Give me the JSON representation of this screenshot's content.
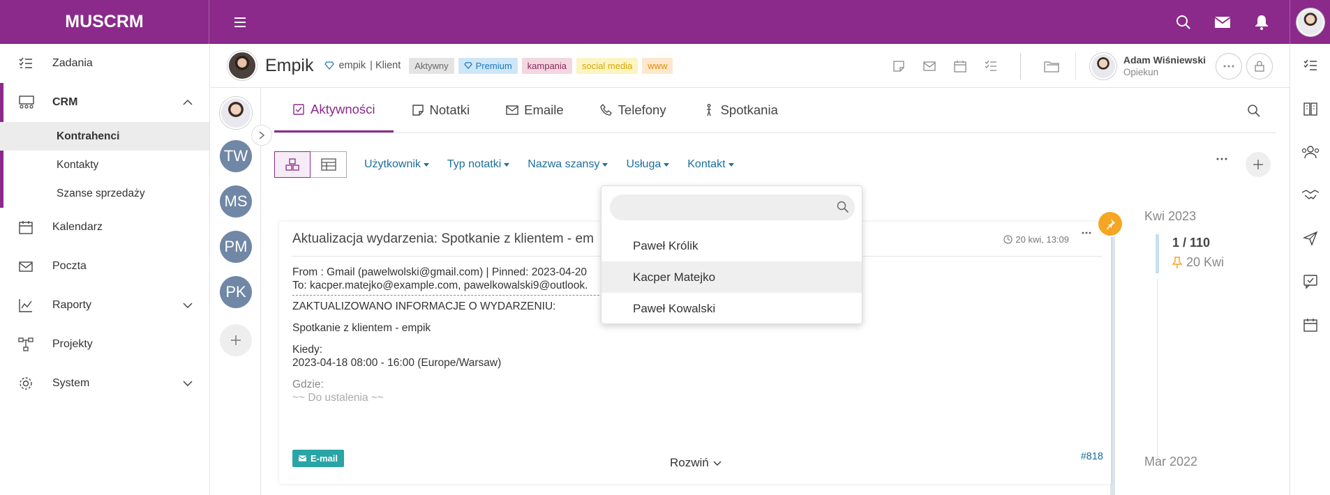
{
  "app": {
    "logo": "MUSCRM"
  },
  "sidebar": {
    "items": [
      {
        "label": "Zadania",
        "icon": "tasks-icon"
      },
      {
        "label": "CRM",
        "icon": "crm-icon"
      },
      {
        "label": "Kalendarz",
        "icon": "calendar-icon"
      },
      {
        "label": "Poczta",
        "icon": "mail-icon"
      },
      {
        "label": "Raporty",
        "icon": "chart-icon"
      },
      {
        "label": "Projekty",
        "icon": "projects-icon"
      },
      {
        "label": "System",
        "icon": "gear-icon"
      }
    ],
    "crm_sub": [
      {
        "label": "Kontrahenci",
        "active": true
      },
      {
        "label": "Kontakty"
      },
      {
        "label": "Szanse sprzedaży"
      }
    ]
  },
  "header": {
    "company": "Empik",
    "client_name": "empik",
    "client_type": "| Klient",
    "tags": [
      {
        "label": "Aktywny",
        "bg": "#e4e4e4",
        "color": "#666"
      },
      {
        "label": "Premium",
        "bg": "#cfe6f7",
        "color": "#1c7ab8"
      },
      {
        "label": "kampania",
        "bg": "#f3d7e0",
        "color": "#8b2a5a"
      },
      {
        "label": "social media",
        "bg": "#fbf4c4",
        "color": "#d6a800"
      },
      {
        "label": "www",
        "bg": "#fde8cf",
        "color": "#e08a00"
      }
    ],
    "owner_name": "Adam Wiśniewski",
    "owner_role": "Opiekun"
  },
  "people": [
    "TW",
    "MS",
    "PM",
    "PK"
  ],
  "tabs": [
    {
      "label": "Aktywności",
      "active": true
    },
    {
      "label": "Notatki"
    },
    {
      "label": "Emaile"
    },
    {
      "label": "Telefony"
    },
    {
      "label": "Spotkania"
    }
  ],
  "filters": [
    "Użytkownik",
    "Typ notatki",
    "Nazwa szansy",
    "Usługa",
    "Kontakt"
  ],
  "card": {
    "title": "Aktualizacja wydarzenia: Spotkanie z klientem - em",
    "date": "20 kwi, 13:09",
    "from": "From : Gmail (pawelwolski@gmail.com) | Pinned: 2023-04-20",
    "to": "To: kacper.matejko@example.com, pawelkowalski9@outlook.",
    "update": "ZAKTUALIZOWANO INFORMACJE O WYDARZENIU:",
    "event": "Spotkanie z klientem - empik",
    "when_label": "Kiedy:",
    "when_value": "2023-04-18 08:00 - 16:00 (Europe/Warsaw)",
    "where_label": "Gdzie:",
    "where_value": "~~ Do ustalenia ~~",
    "badge": "E-mail",
    "expand": "Rozwiń",
    "id": "#818"
  },
  "timeline": {
    "month": "Kwi 2023",
    "count": "1 / 110",
    "pinned": "20 Kwi",
    "month2": "Mar 2022"
  },
  "dropdown": {
    "search_placeholder": "",
    "options": [
      "Paweł Królik",
      "Kacper Matejko",
      "Paweł Kowalski"
    ]
  },
  "colors": {
    "brand": "#8b2a8b",
    "link": "#1c6f9c",
    "avatar_bg": "#7087a5",
    "pin": "#f5a623"
  }
}
